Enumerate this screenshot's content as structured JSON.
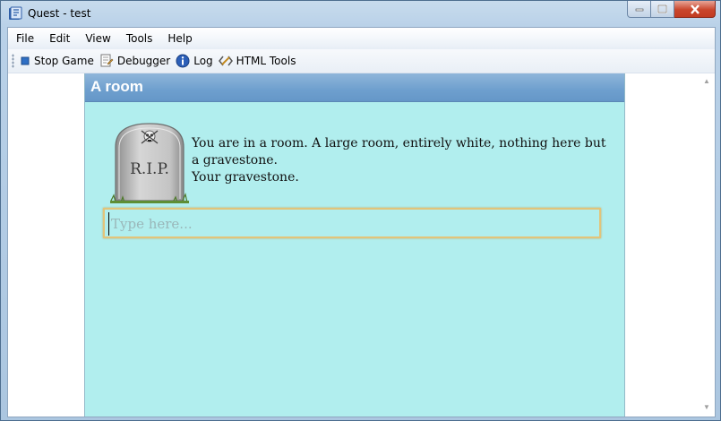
{
  "window": {
    "title": "Quest - test"
  },
  "menu": {
    "items": [
      "File",
      "Edit",
      "View",
      "Tools",
      "Help"
    ]
  },
  "toolbar": {
    "stop_game": "Stop Game",
    "debugger": "Debugger",
    "log": "Log",
    "html_tools": "HTML Tools"
  },
  "game": {
    "location": "A room",
    "gravestone_engraving": "R.I.P.",
    "description_line1": "You are in a room. A large room, entirely white, nothing here but a gravestone.",
    "description_line2": "Your gravestone.",
    "command": {
      "placeholder": "Type here...",
      "value": ""
    }
  },
  "colors": {
    "game_background": "#b1eeee",
    "location_bar": "#6e9fce",
    "command_border": "#e2c47a"
  },
  "icons": {
    "app": "quest-app-icon",
    "stop": "stop-square-icon",
    "debugger": "debugger-icon",
    "log": "info-icon",
    "html_tools": "html-tools-icon"
  }
}
